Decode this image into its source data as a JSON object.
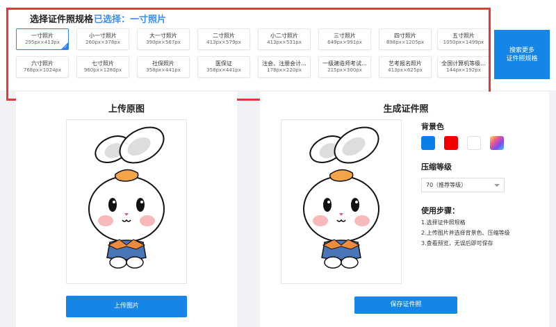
{
  "header": {
    "title": "选择证件照规格",
    "selected": "已选择：一寸照片"
  },
  "sizes": [
    {
      "name": "一寸照片",
      "px": "295px×413px",
      "active": true
    },
    {
      "name": "小一寸照片",
      "px": "260px×378px"
    },
    {
      "name": "大一寸照片",
      "px": "390px×567px"
    },
    {
      "name": "二寸照片",
      "px": "413px×579px"
    },
    {
      "name": "小二寸照片",
      "px": "413px×531px"
    },
    {
      "name": "三寸照片",
      "px": "649px×991px"
    },
    {
      "name": "四寸照片",
      "px": "898px×1205px"
    },
    {
      "name": "五寸照片",
      "px": "1050px×1499px"
    },
    {
      "name": "六寸照片",
      "px": "768px×1024px"
    },
    {
      "name": "七寸照片",
      "px": "960px×1280px"
    },
    {
      "name": "社保照片",
      "px": "358px×441px"
    },
    {
      "name": "医保证",
      "px": "358px×441px"
    },
    {
      "name": "注会、注册会计...",
      "px": "178px×220px"
    },
    {
      "name": "一级建造师考试...",
      "px": "215px×300px"
    },
    {
      "name": "艺考报名照片",
      "px": "413px×625px"
    },
    {
      "name": "全国计算机等级...",
      "px": "144px×192px"
    }
  ],
  "search_more": {
    "line1": "搜索更多",
    "line2": "证件照规格"
  },
  "left_panel": {
    "title": "上传原图",
    "button": "上传图片"
  },
  "right_panel": {
    "title": "生成证件照",
    "bg_label": "背景色",
    "bg_colors": [
      "#0a7ee8",
      "#f20000",
      "#ffffff",
      "gradient"
    ],
    "compress_label": "压缩等级",
    "compress_value": "70（推荐等级）",
    "steps_label": "使用步骤：",
    "steps": [
      "1.选择证件照规格",
      "2.上传图片并选择背景色、压缩等级",
      "3.查看预览，无误后即可保存"
    ],
    "button": "保存证件照"
  },
  "colors": {
    "accent": "#1586e8",
    "highlight": "#e8363c",
    "link": "#3a8ef6"
  }
}
